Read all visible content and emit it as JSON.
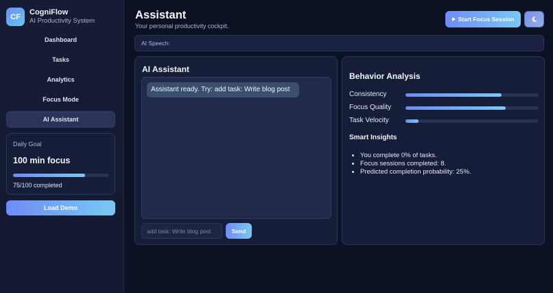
{
  "colors": {
    "background": "#0c1124",
    "sidebar": "#161c35",
    "panel": "#161d38",
    "accent_start": "#6f8cf6",
    "accent_end": "#79c8f2",
    "bubble": "#3a4f6e"
  },
  "brand": {
    "logo": "CF",
    "name": "CogniFlow",
    "subtitle": "AI Productivity System"
  },
  "nav": {
    "items": [
      {
        "label": "Dashboard"
      },
      {
        "label": "Tasks"
      },
      {
        "label": "Analytics"
      },
      {
        "label": "Focus Mode"
      },
      {
        "label": "AI Assistant",
        "active": true
      }
    ]
  },
  "goal": {
    "label": "Daily Goal",
    "value": "100 min focus",
    "progress": 0.75,
    "caption": "75/100 completed"
  },
  "demo_button": "Load Demo",
  "header": {
    "title": "Assistant",
    "subtitle": "Your personal productivity cockpit.",
    "focus_button": "Start Focus Session",
    "theme_icon": "moon-icon"
  },
  "speech": {
    "label": "AI Speech:"
  },
  "assistant": {
    "title": "AI Assistant",
    "message": "Assistant ready. Try: add task: Write blog post",
    "input_placeholder": "add task: Write blog post",
    "send": "Send"
  },
  "behavior": {
    "title": "Behavior Analysis",
    "metrics": [
      {
        "label": "Consistency",
        "value": 0.72
      },
      {
        "label": "Focus Quality",
        "value": 0.75
      },
      {
        "label": "Task Velocity",
        "value": 0.1
      }
    ],
    "insights_title": "Smart Insights",
    "insights": [
      "You complete 0% of tasks.",
      "Focus sessions completed: 8.",
      "Predicted completion probability: 25%."
    ]
  }
}
